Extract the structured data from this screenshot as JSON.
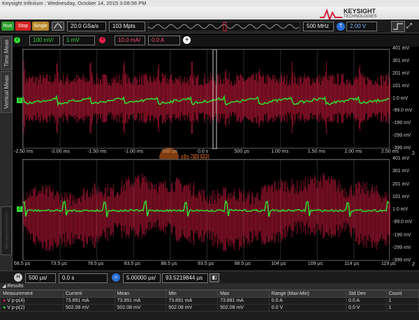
{
  "titlebar": {
    "text": "Keysight Infiniium : Wednesday, October 14, 2015 3:08:56 PM"
  },
  "brand": {
    "name": "KEYSIGHT",
    "sub": "TECHNOLOGIES"
  },
  "runbar": {
    "run": "Run",
    "stop": "Stop",
    "single": "Single",
    "sample_rate": "20.0 GSa/s",
    "points": "103 Mpts",
    "bandwidth": "500 MHz",
    "trigger_level": "2.00 V"
  },
  "channels": {
    "ch2_scale": "100 mV/",
    "ch2_offset": "1 mV",
    "ch4_scale": "10.0 mA/",
    "ch4_offset": "0.0 A"
  },
  "sidetabs": [
    "Time Meas",
    "Vertical Meas",
    "Measurements"
  ],
  "watermark": "电源网",
  "top_grid": {
    "ylabels": [
      "401 mV",
      "301 mV",
      "201 mV",
      "101 mV",
      "1.0 mV",
      "-99.0 mV",
      "-199 mV",
      "-299 mV",
      "-399 mV"
    ],
    "xlabels": [
      "-2.50 ms",
      "-2.00 ms",
      "-1.50 ms",
      "-1.00 ms",
      "-500 µs",
      "0.0 s",
      "500 µs",
      "1.00 ms",
      "1.50 ms",
      "2.00 ms",
      "2.50 ms"
    ],
    "count": "2"
  },
  "bottom_grid": {
    "ylabels": [
      "401 mV",
      "301 mV",
      "201 mV",
      "101 mV",
      "1.0 mV",
      "-99.0 mV",
      "-199 mV",
      "-299 mV",
      "-399 mV"
    ],
    "xlabels": [
      "68.5 µs",
      "73.5 µs",
      "78.5 µs",
      "83.5 µs",
      "88.5 µs",
      "93.5 µs",
      "98.5 µs",
      "104 µs",
      "109 µs",
      "114 µs",
      "119 µs"
    ],
    "count": "2"
  },
  "hbar": {
    "h_label": "H",
    "scale": "500 µs/",
    "position": "0.0 s",
    "zoom_scale": "5.00000 µs/",
    "zoom_position": "93.5219844 µs"
  },
  "results": {
    "title": "Results",
    "headers": [
      "Measurement",
      "Current",
      "Mean",
      "Min",
      "Max",
      "Range (Max-Min)",
      "Std Dev",
      "Count"
    ],
    "rows": [
      [
        "V p-p(4)",
        "73.891 mA",
        "73.891 mA",
        "73.891 mA",
        "73.891 mA",
        "0.0 A",
        "0.0 A",
        "1"
      ],
      [
        "V p-p(2)",
        "502.08 mV",
        "502.08 mV",
        "502.08 mV",
        "502.08 mV",
        "0.0 V",
        "0.0 V",
        "1"
      ]
    ]
  },
  "colors": {
    "ch2": "#33dd33",
    "ch4": "#ff1f4b",
    "accent": "#d01f3c"
  }
}
